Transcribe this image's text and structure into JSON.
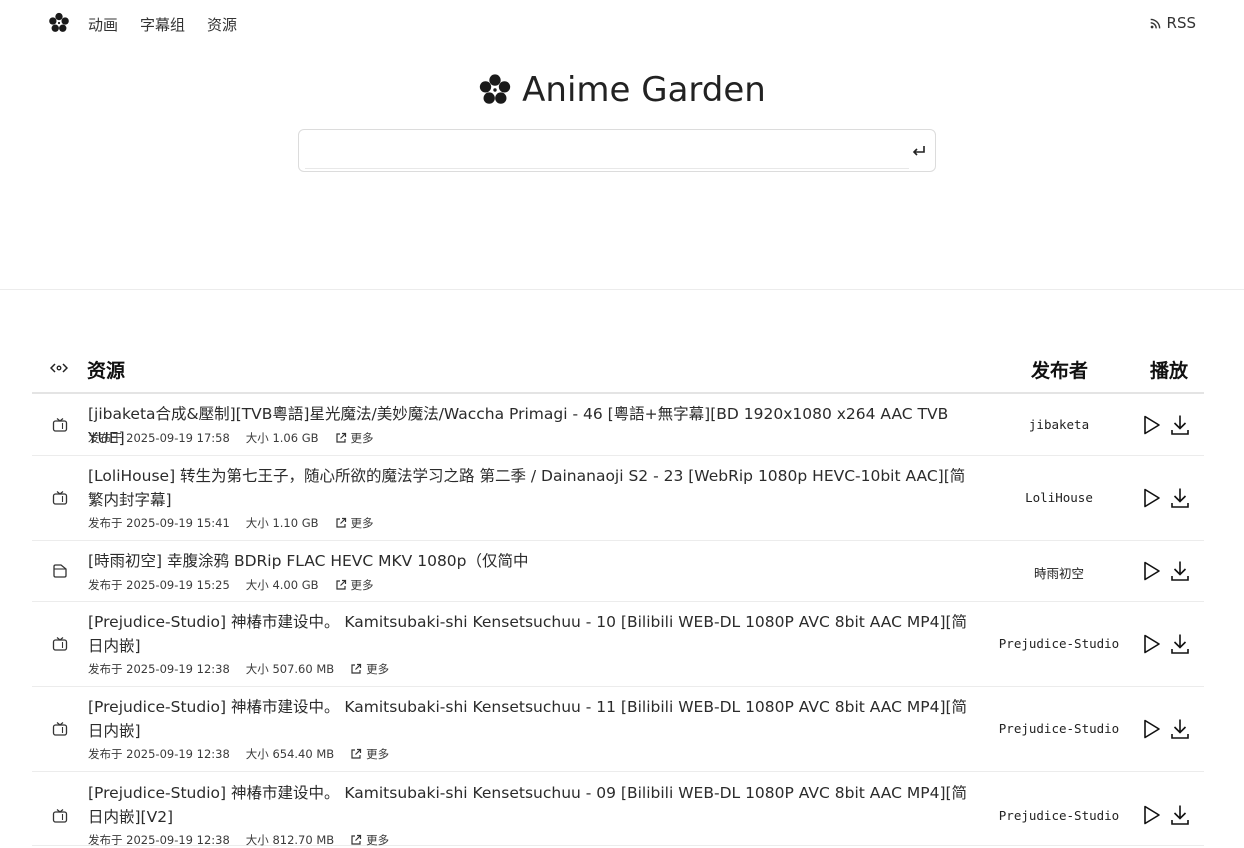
{
  "nav": {
    "items": [
      "动画",
      "字幕组",
      "资源"
    ],
    "rss": "RSS"
  },
  "hero": {
    "title": "Anime Garden"
  },
  "search": {
    "value": "",
    "placeholder": ""
  },
  "table": {
    "headers": {
      "resource": "资源",
      "publisher": "发布者",
      "play": "播放"
    },
    "rows": [
      {
        "title": "[jibaketa合成&壓制][TVB粵語]星光魔法/美妙魔法/Waccha Primagi - 46 [粵語+無字幕][BD 1920x1080 x264 AAC TVB YUE]",
        "published": "发布于 2025-09-19 17:58",
        "size": "大小 1.06 GB",
        "more": "更多",
        "publisher": "jibaketa",
        "icon": "tv-icon"
      },
      {
        "title": "[LoliHouse] 转生为第七王子，随心所欲的魔法学习之路 第二季 / Dainanaoji S2 - 23 [WebRip 1080p HEVC-10bit AAC][简繁内封字幕]",
        "published": "发布于 2025-09-19 15:41",
        "size": "大小 1.10 GB",
        "more": "更多",
        "publisher": "LoliHouse",
        "icon": "tv-icon"
      },
      {
        "title": "[時雨初空] 幸腹涂鸦 BDRip FLAC HEVC MKV 1080p（仅简中",
        "published": "发布于 2025-09-19 15:25",
        "size": "大小 4.00 GB",
        "more": "更多",
        "publisher": "時雨初空",
        "icon": "collection-icon"
      },
      {
        "title": "[Prejudice-Studio] 神椿市建设中。 Kamitsubaki-shi Kensetsuchuu - 10 [Bilibili WEB-DL 1080P AVC 8bit AAC MP4][简日内嵌]",
        "published": "发布于 2025-09-19 12:38",
        "size": "大小 507.60 MB",
        "more": "更多",
        "publisher": "Prejudice-Studio",
        "icon": "tv-icon"
      },
      {
        "title": "[Prejudice-Studio] 神椿市建设中。 Kamitsubaki-shi Kensetsuchuu - 11 [Bilibili WEB-DL 1080P AVC 8bit AAC MP4][简日内嵌]",
        "published": "发布于 2025-09-19 12:38",
        "size": "大小 654.40 MB",
        "more": "更多",
        "publisher": "Prejudice-Studio",
        "icon": "tv-icon"
      },
      {
        "title": "[Prejudice-Studio] 神椿市建设中。 Kamitsubaki-shi Kensetsuchuu - 09 [Bilibili WEB-DL 1080P AVC 8bit AAC MP4][简日内嵌][V2]",
        "published": "发布于 2025-09-19 12:38",
        "size": "大小 812.70 MB",
        "more": "更多",
        "publisher": "Prejudice-Studio",
        "icon": "tv-icon"
      }
    ]
  }
}
